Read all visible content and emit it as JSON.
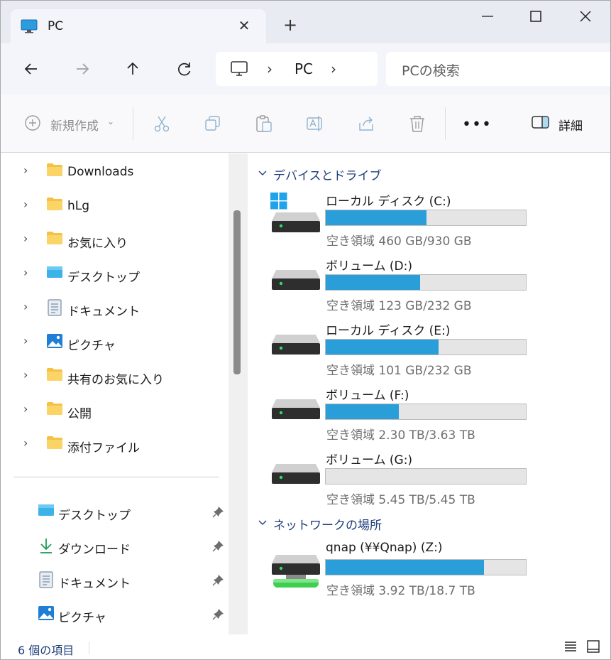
{
  "tab": {
    "title": "PC",
    "icon": "monitor-icon"
  },
  "address": {
    "location": "PC",
    "separator": "›"
  },
  "search": {
    "placeholder": "PCの検索"
  },
  "toolbar": {
    "new_label": "新規作成",
    "more_label": "•••",
    "details_label": "詳細"
  },
  "sidebar": {
    "tree": [
      {
        "label": "Downloads",
        "icon": "folder-icon"
      },
      {
        "label": "hLg",
        "icon": "folder-icon"
      },
      {
        "label": "お気に入り",
        "icon": "folder-icon"
      },
      {
        "label": "デスクトップ",
        "icon": "desktop-icon"
      },
      {
        "label": "ドキュメント",
        "icon": "document-icon"
      },
      {
        "label": "ピクチャ",
        "icon": "picture-icon"
      },
      {
        "label": "共有のお気に入り",
        "icon": "folder-icon"
      },
      {
        "label": "公開",
        "icon": "folder-icon"
      },
      {
        "label": "添付ファイル",
        "icon": "folder-icon"
      }
    ],
    "pinned": [
      {
        "label": "デスクトップ",
        "icon": "desktop-icon"
      },
      {
        "label": "ダウンロード",
        "icon": "download-icon"
      },
      {
        "label": "ドキュメント",
        "icon": "document-icon"
      },
      {
        "label": "ピクチャ",
        "icon": "picture-icon"
      }
    ]
  },
  "main": {
    "sections": [
      {
        "label": "デバイスとドライブ"
      },
      {
        "label": "ネットワークの場所"
      }
    ],
    "drives": [
      {
        "name": "ローカル ディスク (C:)",
        "free": "空き領域 460 GB/930 GB",
        "used_fraction": 0.505,
        "windows": true
      },
      {
        "name": "ボリューム (D:)",
        "free": "空き領域 123 GB/232 GB",
        "used_fraction": 0.47
      },
      {
        "name": "ローカル ディスク (E:)",
        "free": "空き領域 101 GB/232 GB",
        "used_fraction": 0.565
      },
      {
        "name": "ボリューム (F:)",
        "free": "空き領域 2.30 TB/3.63 TB",
        "used_fraction": 0.366
      },
      {
        "name": "ボリューム (G:)",
        "free": "空き領域 5.45 TB/5.45 TB",
        "used_fraction": 0.0
      }
    ],
    "network": [
      {
        "name": "qnap (¥¥Qnap) (Z:)",
        "free": "空き領域 3.92 TB/18.7 TB",
        "used_fraction": 0.79
      }
    ]
  },
  "status": {
    "count": "6 個の項目"
  },
  "colors": {
    "accent": "#2a9ed8",
    "section": "#1f3f7a"
  }
}
